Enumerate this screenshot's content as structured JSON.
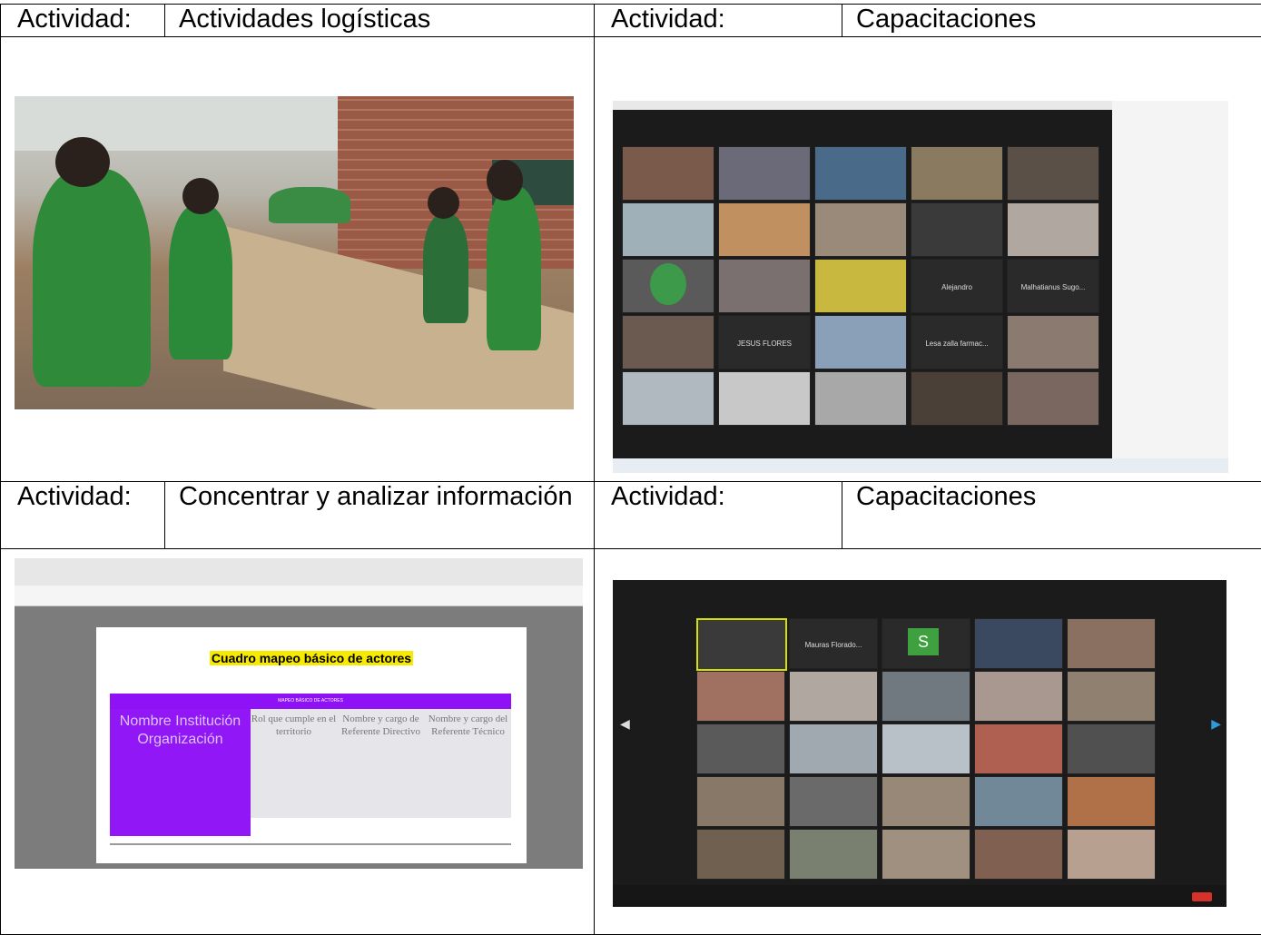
{
  "table": {
    "label": "Actividad:",
    "rows": [
      {
        "left_value": "Actividades logísticas",
        "right_value": "Capacitaciones"
      },
      {
        "left_value": "Concentrar y analizar información",
        "right_value": "Capacitaciones"
      }
    ]
  },
  "document_image": {
    "title": "Cuadro mapeo básico de actores",
    "band": "MAPEO BÁSICO DE ACTORES",
    "first_column": "Nombre Institución Organización",
    "columns": [
      "Rol que cumple en el territorio",
      "Nombre y cargo de Referente Directivo",
      "Nombre y cargo del Referente Técnico"
    ]
  },
  "zoom_tiles": {
    "top_gallery_names": [
      "JESUS FLORES",
      "Alejandro",
      "Malhatianus Sugo...",
      "Lesa zalla farmac..."
    ],
    "bottom_gallery_names": [
      "Mauras Florado...",
      "S"
    ]
  },
  "colors": {
    "border": "#000000",
    "purple": "#8f11f5",
    "highlight": "#f7e900",
    "zoom_bg": "#1b1b1b"
  }
}
